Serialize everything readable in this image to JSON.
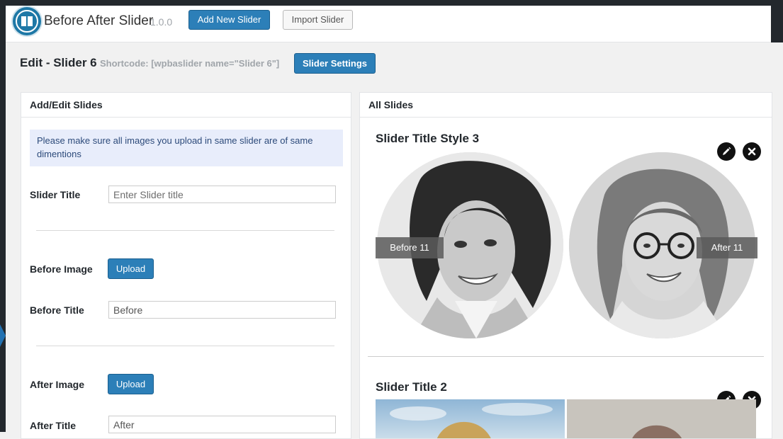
{
  "header": {
    "app_title": "Before After Slider",
    "version": "1.0.0",
    "add_new_label": "Add New Slider",
    "import_label": "Import Slider"
  },
  "page": {
    "title": "Edit - Slider 6",
    "shortcode": "Shortcode: [wpbaslider name=\"Slider 6\"]",
    "settings_label": "Slider Settings"
  },
  "add_edit_panel": {
    "heading": "Add/Edit Slides",
    "notice": "Please make sure all images you upload in same slider are of same dimentions",
    "slider_title_label": "Slider Title",
    "slider_title_placeholder": "Enter Slider title",
    "before_image_label": "Before Image",
    "upload_label": "Upload",
    "before_title_label": "Before Title",
    "before_title_value": "Before",
    "after_image_label": "After Image",
    "after_title_label": "After Title",
    "after_title_value": "After"
  },
  "all_slides_panel": {
    "heading": "All Slides",
    "slides": [
      {
        "title": "Slider Title Style 3",
        "before_tag": "Before 11",
        "after_tag": "After 11"
      },
      {
        "title": "Slider Title 2"
      }
    ]
  },
  "colors": {
    "accent": "#2c7fb8",
    "admin_bar": "#23282d",
    "notice_bg": "#e8edfb"
  }
}
